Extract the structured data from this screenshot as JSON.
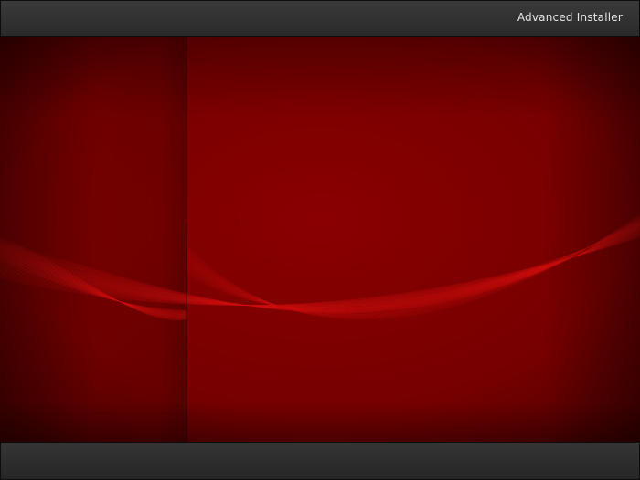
{
  "window": {
    "title": "Advanced Installer"
  },
  "background": {
    "base_color": "#7a0000",
    "dark_color": "#3a0000",
    "wave_color": "#d01010"
  }
}
